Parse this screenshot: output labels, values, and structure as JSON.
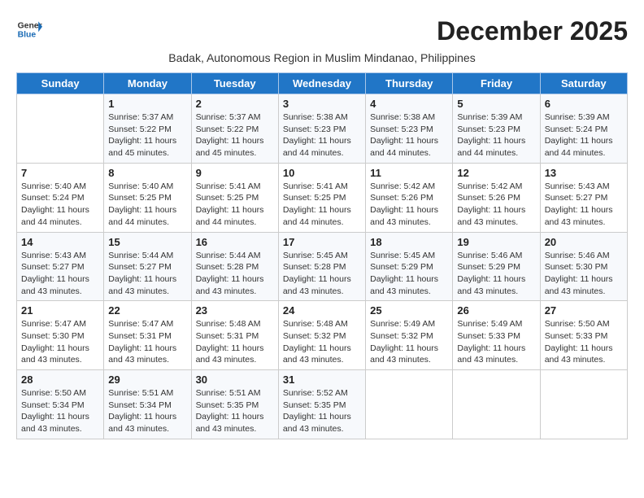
{
  "header": {
    "logo_line1": "General",
    "logo_line2": "Blue",
    "month_title": "December 2025",
    "subtitle": "Badak, Autonomous Region in Muslim Mindanao, Philippines"
  },
  "days_of_week": [
    "Sunday",
    "Monday",
    "Tuesday",
    "Wednesday",
    "Thursday",
    "Friday",
    "Saturday"
  ],
  "weeks": [
    [
      {
        "day": "",
        "info": ""
      },
      {
        "day": "1",
        "info": "Sunrise: 5:37 AM\nSunset: 5:22 PM\nDaylight: 11 hours\nand 45 minutes."
      },
      {
        "day": "2",
        "info": "Sunrise: 5:37 AM\nSunset: 5:22 PM\nDaylight: 11 hours\nand 45 minutes."
      },
      {
        "day": "3",
        "info": "Sunrise: 5:38 AM\nSunset: 5:23 PM\nDaylight: 11 hours\nand 44 minutes."
      },
      {
        "day": "4",
        "info": "Sunrise: 5:38 AM\nSunset: 5:23 PM\nDaylight: 11 hours\nand 44 minutes."
      },
      {
        "day": "5",
        "info": "Sunrise: 5:39 AM\nSunset: 5:23 PM\nDaylight: 11 hours\nand 44 minutes."
      },
      {
        "day": "6",
        "info": "Sunrise: 5:39 AM\nSunset: 5:24 PM\nDaylight: 11 hours\nand 44 minutes."
      }
    ],
    [
      {
        "day": "7",
        "info": "Sunrise: 5:40 AM\nSunset: 5:24 PM\nDaylight: 11 hours\nand 44 minutes."
      },
      {
        "day": "8",
        "info": "Sunrise: 5:40 AM\nSunset: 5:25 PM\nDaylight: 11 hours\nand 44 minutes."
      },
      {
        "day": "9",
        "info": "Sunrise: 5:41 AM\nSunset: 5:25 PM\nDaylight: 11 hours\nand 44 minutes."
      },
      {
        "day": "10",
        "info": "Sunrise: 5:41 AM\nSunset: 5:25 PM\nDaylight: 11 hours\nand 44 minutes."
      },
      {
        "day": "11",
        "info": "Sunrise: 5:42 AM\nSunset: 5:26 PM\nDaylight: 11 hours\nand 43 minutes."
      },
      {
        "day": "12",
        "info": "Sunrise: 5:42 AM\nSunset: 5:26 PM\nDaylight: 11 hours\nand 43 minutes."
      },
      {
        "day": "13",
        "info": "Sunrise: 5:43 AM\nSunset: 5:27 PM\nDaylight: 11 hours\nand 43 minutes."
      }
    ],
    [
      {
        "day": "14",
        "info": "Sunrise: 5:43 AM\nSunset: 5:27 PM\nDaylight: 11 hours\nand 43 minutes."
      },
      {
        "day": "15",
        "info": "Sunrise: 5:44 AM\nSunset: 5:27 PM\nDaylight: 11 hours\nand 43 minutes."
      },
      {
        "day": "16",
        "info": "Sunrise: 5:44 AM\nSunset: 5:28 PM\nDaylight: 11 hours\nand 43 minutes."
      },
      {
        "day": "17",
        "info": "Sunrise: 5:45 AM\nSunset: 5:28 PM\nDaylight: 11 hours\nand 43 minutes."
      },
      {
        "day": "18",
        "info": "Sunrise: 5:45 AM\nSunset: 5:29 PM\nDaylight: 11 hours\nand 43 minutes."
      },
      {
        "day": "19",
        "info": "Sunrise: 5:46 AM\nSunset: 5:29 PM\nDaylight: 11 hours\nand 43 minutes."
      },
      {
        "day": "20",
        "info": "Sunrise: 5:46 AM\nSunset: 5:30 PM\nDaylight: 11 hours\nand 43 minutes."
      }
    ],
    [
      {
        "day": "21",
        "info": "Sunrise: 5:47 AM\nSunset: 5:30 PM\nDaylight: 11 hours\nand 43 minutes."
      },
      {
        "day": "22",
        "info": "Sunrise: 5:47 AM\nSunset: 5:31 PM\nDaylight: 11 hours\nand 43 minutes."
      },
      {
        "day": "23",
        "info": "Sunrise: 5:48 AM\nSunset: 5:31 PM\nDaylight: 11 hours\nand 43 minutes."
      },
      {
        "day": "24",
        "info": "Sunrise: 5:48 AM\nSunset: 5:32 PM\nDaylight: 11 hours\nand 43 minutes."
      },
      {
        "day": "25",
        "info": "Sunrise: 5:49 AM\nSunset: 5:32 PM\nDaylight: 11 hours\nand 43 minutes."
      },
      {
        "day": "26",
        "info": "Sunrise: 5:49 AM\nSunset: 5:33 PM\nDaylight: 11 hours\nand 43 minutes."
      },
      {
        "day": "27",
        "info": "Sunrise: 5:50 AM\nSunset: 5:33 PM\nDaylight: 11 hours\nand 43 minutes."
      }
    ],
    [
      {
        "day": "28",
        "info": "Sunrise: 5:50 AM\nSunset: 5:34 PM\nDaylight: 11 hours\nand 43 minutes."
      },
      {
        "day": "29",
        "info": "Sunrise: 5:51 AM\nSunset: 5:34 PM\nDaylight: 11 hours\nand 43 minutes."
      },
      {
        "day": "30",
        "info": "Sunrise: 5:51 AM\nSunset: 5:35 PM\nDaylight: 11 hours\nand 43 minutes."
      },
      {
        "day": "31",
        "info": "Sunrise: 5:52 AM\nSunset: 5:35 PM\nDaylight: 11 hours\nand 43 minutes."
      },
      {
        "day": "",
        "info": ""
      },
      {
        "day": "",
        "info": ""
      },
      {
        "day": "",
        "info": ""
      }
    ]
  ]
}
